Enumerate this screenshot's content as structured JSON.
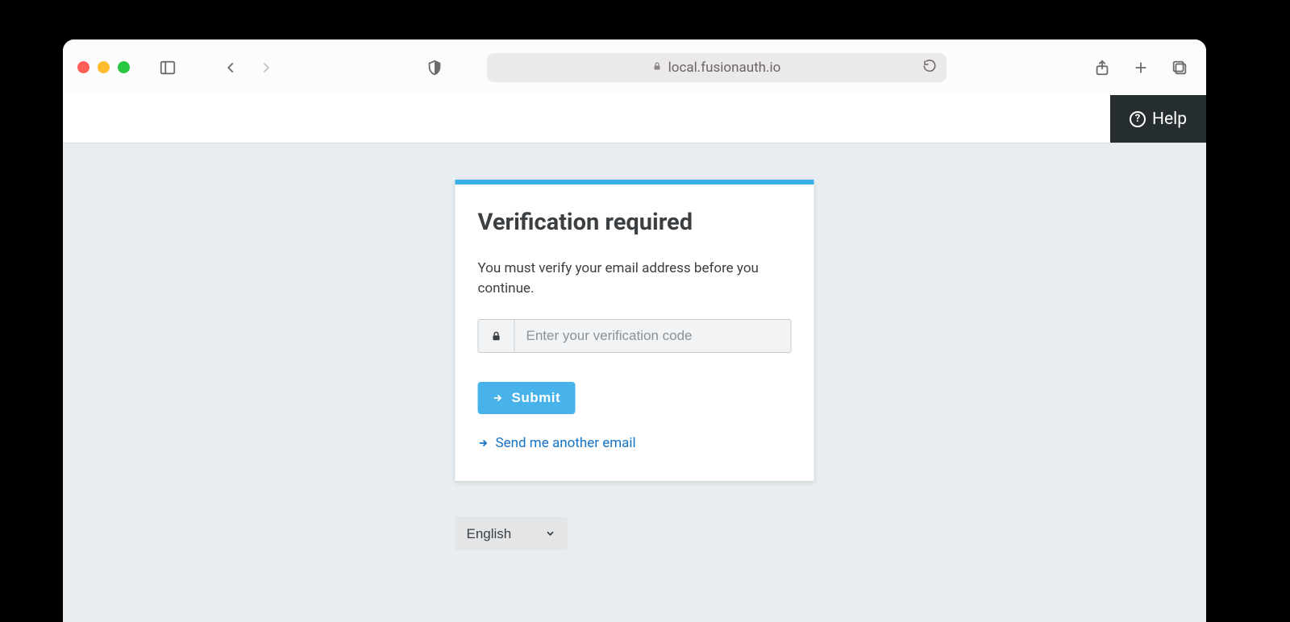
{
  "browser": {
    "url": "local.fusionauth.io"
  },
  "topbar": {
    "help_label": "Help"
  },
  "card": {
    "title": "Verification required",
    "message": "You must verify your email address before you continue.",
    "input_placeholder": "Enter your verification code",
    "submit_label": "Submit",
    "resend_link": "Send me another email"
  },
  "language": {
    "selected": "English",
    "options": [
      "English"
    ]
  }
}
